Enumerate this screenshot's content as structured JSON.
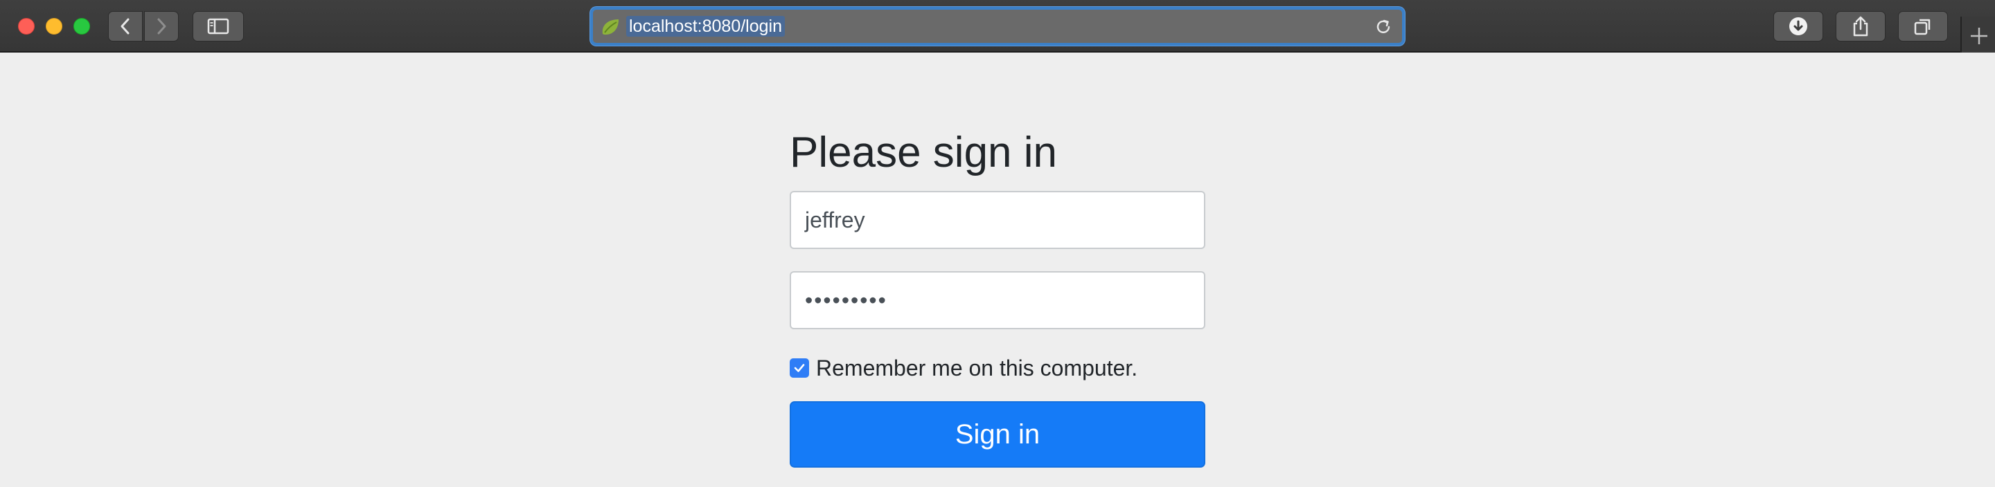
{
  "browser": {
    "url": "localhost:8080/login",
    "favicon": "spring-leaf-icon",
    "accent_color": "#3b80c8"
  },
  "login": {
    "heading": "Please sign in",
    "username_value": "jeffrey",
    "password_value": "•••••••••",
    "remember_label": "Remember me on this computer.",
    "remember_checked": true,
    "submit_label": "Sign in",
    "button_color": "#157bf7"
  }
}
